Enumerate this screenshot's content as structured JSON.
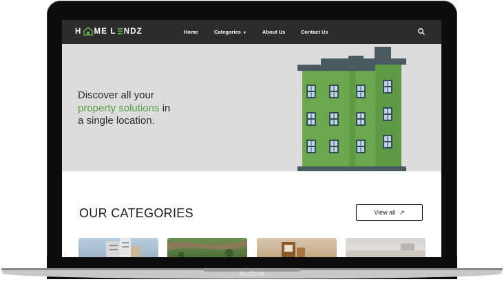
{
  "device": {
    "label": "MacBook"
  },
  "nav": {
    "logo": {
      "before": "H",
      "after": "ME L",
      "after2": "NDZ"
    },
    "links": [
      {
        "label": "Home"
      },
      {
        "label": "Categories"
      },
      {
        "label": "About Us"
      },
      {
        "label": "Contact Us"
      }
    ],
    "categories_caret": "▾"
  },
  "hero": {
    "line1": "Discover all your",
    "accent": "property solutions",
    "line2_rest": " in",
    "line3": "a single location."
  },
  "categories": {
    "title": "OUR CATEGORIES",
    "view_all_label": "View all",
    "view_all_arrow": "↗"
  },
  "colors": {
    "navbar": "#2c2c2c",
    "accent_green": "#5a9e4c",
    "building_green": "#6aa84f",
    "building_dark": "#4a5a63",
    "hero_bg": "#dcdcdc"
  }
}
